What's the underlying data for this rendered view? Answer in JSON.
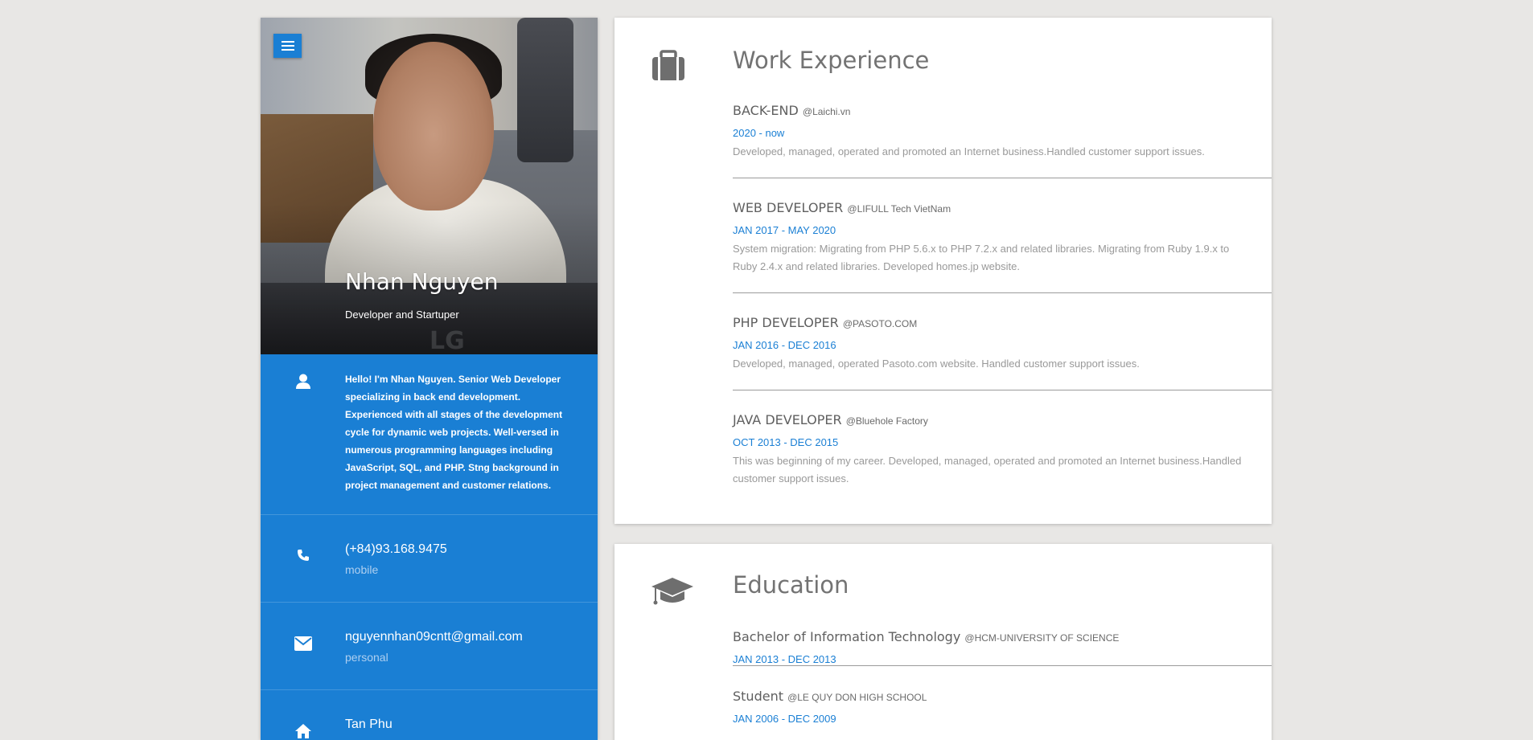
{
  "profile": {
    "name": "Nhan Nguyen",
    "role": "Developer and Startuper",
    "about": "Hello! I'm Nhan Nguyen. Senior Web Developer specializing in back end development. Experienced with all stages of the development cycle for dynamic web projects. Well-versed in numerous programming languages including JavaScript, SQL, and PHP. Stng background in project management and customer relations."
  },
  "contacts": [
    {
      "icon": "phone-icon",
      "value": "(+84)93.168.9475",
      "label": "mobile"
    },
    {
      "icon": "envelope-icon",
      "value": "nguyennhan09cntt@gmail.com",
      "label": "personal"
    },
    {
      "icon": "home-icon",
      "value": "Tan Phu",
      "label": ""
    }
  ],
  "work": {
    "title": "Work Experience",
    "entries": [
      {
        "position": "BACK-END",
        "company": "@Laichi.vn",
        "date": "2020 - now",
        "description": "Developed, managed, operated and promoted an Internet business.Handled customer support issues."
      },
      {
        "position": "WEB DEVELOPER",
        "company": "@LIFULL Tech VietNam",
        "date": "JAN 2017 - MAY 2020",
        "description": "System migration: Migrating from PHP 5.6.x to PHP 7.2.x and related libraries. Migrating from Ruby 1.9.x to Ruby 2.4.x and related libraries. Developed homes.jp website."
      },
      {
        "position": "PHP DEVELOPER",
        "company": "@PASOTO.COM",
        "date": "JAN 2016 - DEC 2016",
        "description": "Developed, managed, operated Pasoto.com website. Handled customer support issues."
      },
      {
        "position": "JAVA DEVELOPER",
        "company": "@Bluehole Factory",
        "date": "OCT 2013 - DEC 2015",
        "description": "This was beginning of my career. Developed, managed, operated and promoted an Internet business.Handled customer support issues."
      }
    ]
  },
  "education": {
    "title": "Education",
    "entries": [
      {
        "degree": "Bachelor of Information Technology",
        "school": "@HCM-UNIVERSITY OF SCIENCE",
        "date": "JAN 2013 - DEC 2013"
      },
      {
        "degree": "Student",
        "school": "@LE QUY DON HIGH SCHOOL",
        "date": "JAN 2006 - DEC 2009"
      }
    ]
  },
  "colors": {
    "accent": "#1a7fd4",
    "background": "#e8e7e5",
    "title": "#737373"
  }
}
